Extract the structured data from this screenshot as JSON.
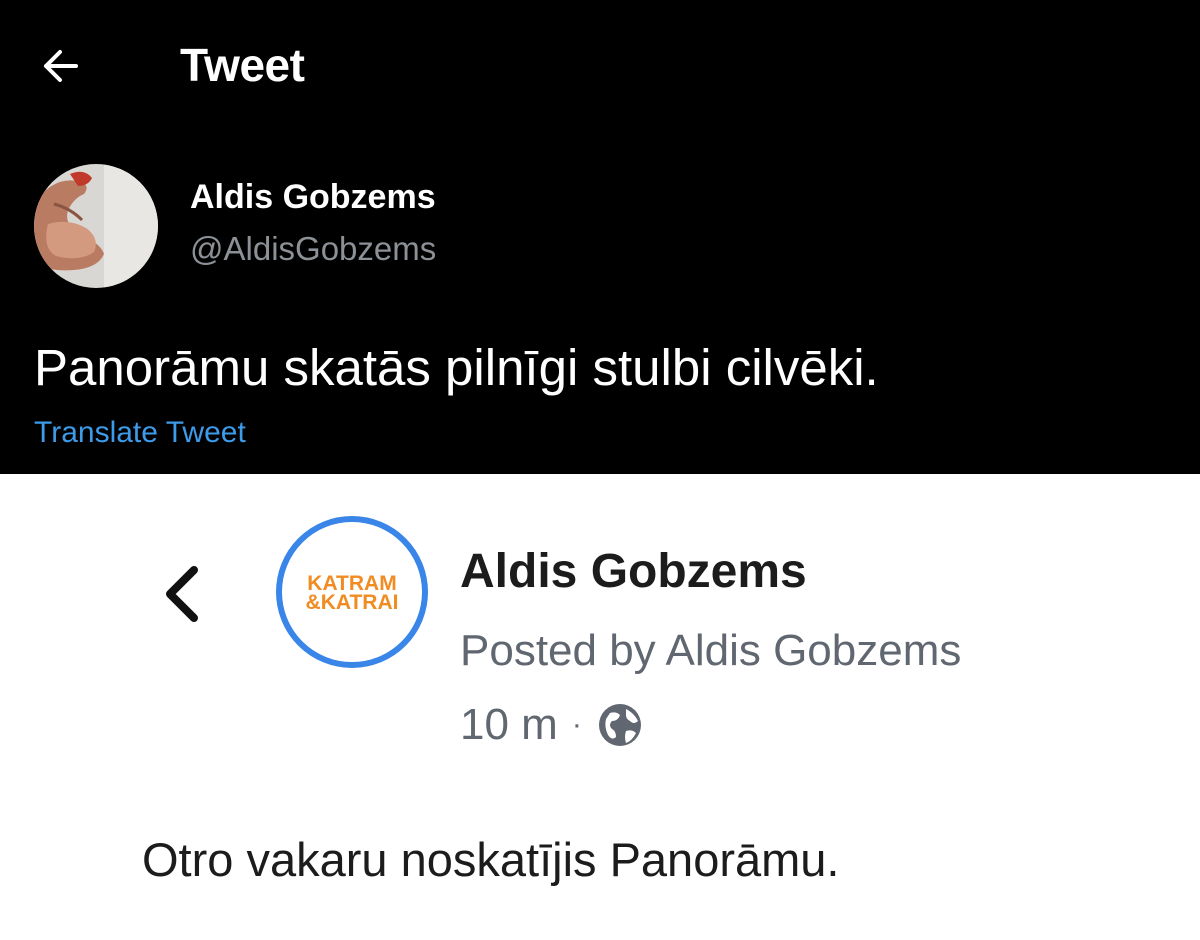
{
  "tweet_header": {
    "back_icon": "arrow-left-icon",
    "title": "Tweet"
  },
  "author": {
    "name": "Aldis Gobzems",
    "handle": "@AldisGobzems"
  },
  "tweet": {
    "text": "Panorāmu skatās pilnīgi stulbi cilvēki.",
    "translate_label": "Translate Tweet",
    "translate_color": "#3d9be9"
  },
  "embedded_post": {
    "back_icon": "chevron-left-icon",
    "logo_lines": [
      "KATRAM",
      "&KATRAI"
    ],
    "page_name": "Aldis Gobzems",
    "posted_by": "Posted by Aldis Gobzems",
    "time": "10 m",
    "separator": "·",
    "audience_icon": "globe-icon",
    "text": "Otro vakaru noskatījis Panorāmu.",
    "ring_color": "#3a86e8",
    "logo_color": "#f08c22"
  }
}
